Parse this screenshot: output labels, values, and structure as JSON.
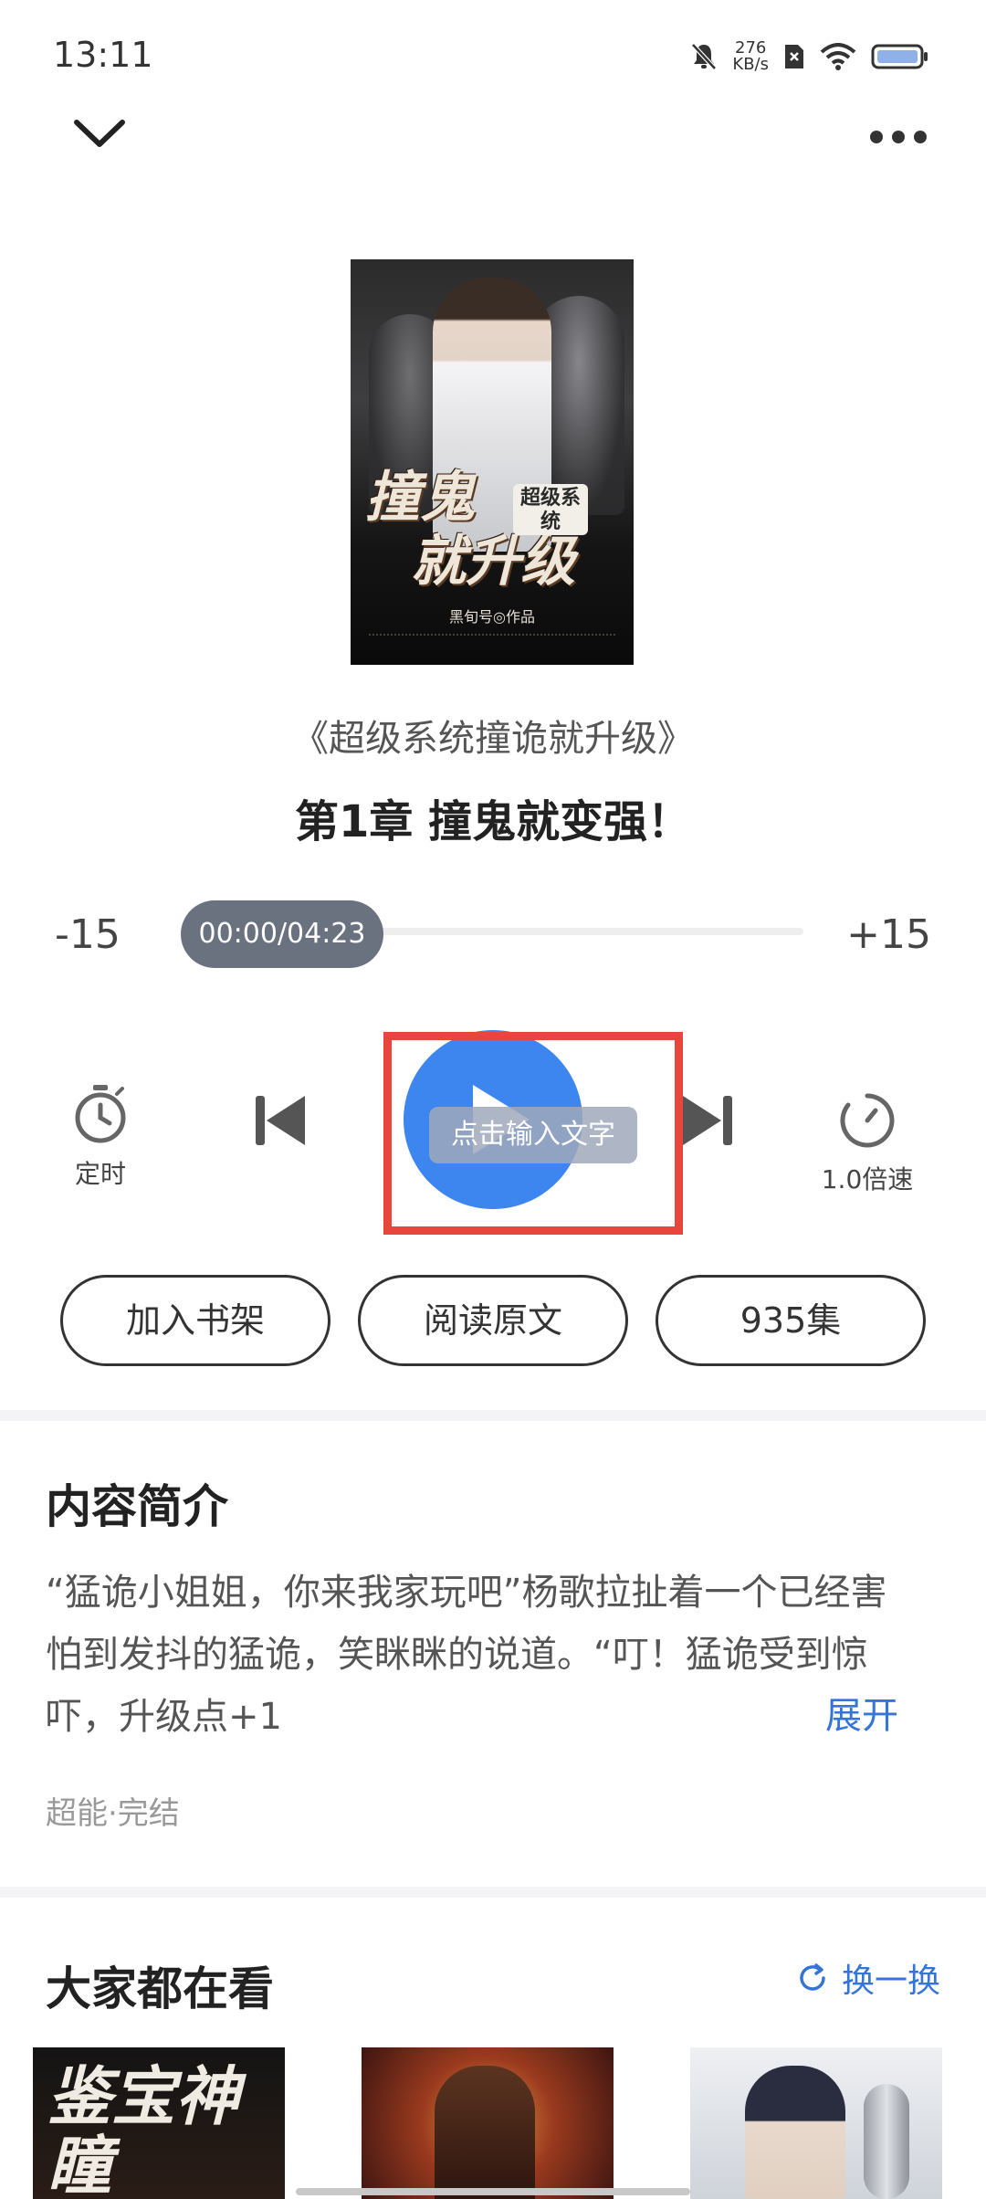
{
  "status_bar": {
    "time": "13:11",
    "net_speed_value": "276",
    "net_speed_unit": "KB/s",
    "icons": [
      "mute-bell-icon",
      "sim-x-icon",
      "wifi-icon",
      "battery-icon"
    ]
  },
  "nav": {
    "back_icon": "chevron-down-icon",
    "more_icon": "more-dots-icon"
  },
  "cover": {
    "title_line1": "撞鬼",
    "title_line2": "就升级",
    "badge": "超级系统",
    "author": "黑旬号◎作品"
  },
  "book_title": "《超级系统撞诡就升级》",
  "chapter_title": "第1章 撞鬼就变强！",
  "player": {
    "seek_back": "-15",
    "seek_forward": "+15",
    "time_display": "00:00/04:23",
    "progress": 0,
    "timer_label": "定时",
    "speed_label": "1.0倍速",
    "text_tip": "点击输入文字"
  },
  "actions": {
    "add_shelf": "加入书架",
    "read_original": "阅读原文",
    "episodes": "935集"
  },
  "intro": {
    "heading": "内容简介",
    "text": "“猛诡小姐姐，你来我家玩吧”杨歌拉扯着一个已经害怕到发抖的猛诡，笑眯眯的说道。“叮！猛诡受到惊吓，升级点+1",
    "expand": "展开",
    "tags": "超能·完结"
  },
  "recommend": {
    "heading": "大家都在看",
    "refresh": "换一换",
    "card1_title": "鉴宝神瞳"
  },
  "colors": {
    "accent_blue": "#3d86f0",
    "link_blue": "#3574d8",
    "highlight_red": "#e8453c",
    "pill_gray": "#6a7280"
  }
}
